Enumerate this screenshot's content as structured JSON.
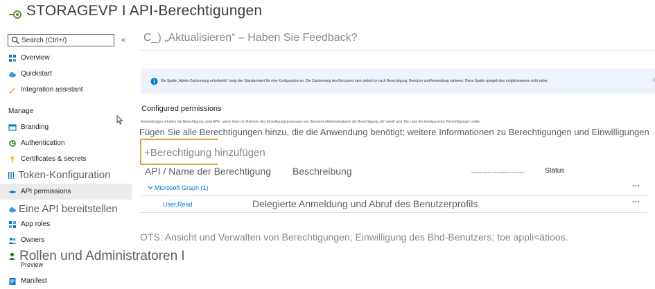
{
  "app": {
    "title": "STORAGEVP I API-Berechtigungen"
  },
  "sidebar": {
    "search_placeholder": "Search (Ctrl+/)",
    "collapse_label": "«",
    "manage_label": "Manage",
    "items": [
      {
        "label": "Overview",
        "icon": "grid-icon"
      },
      {
        "label": "Quickstart",
        "icon": "cloud-icon"
      },
      {
        "label": "Integration assistant",
        "icon": "rocket-icon"
      },
      {
        "label": "Branding",
        "icon": "branding-icon"
      },
      {
        "label": "Authentication",
        "icon": "authentication-icon"
      },
      {
        "label": "Certificates & secrets",
        "icon": "key-icon"
      },
      {
        "label": "Token-Konfiguration",
        "icon": "token-config-icon"
      },
      {
        "label": "API permissions",
        "icon": "api-permissions-icon"
      },
      {
        "label": "Eine API bereitstellen",
        "icon": "cloud-api-icon"
      },
      {
        "label": "App roles",
        "icon": "app-roles-icon"
      },
      {
        "label": "Owners",
        "icon": "owners-icon"
      },
      {
        "label": "Preview",
        "icon": ""
      },
      {
        "label": "Manifest",
        "icon": "manifest-icon"
      }
    ],
    "overlay_label": "Rollen und Administratoren I"
  },
  "command_bar": {
    "text": "C_) „Aktualisieren“ – Haben Sie Feedback?"
  },
  "info_bar": {
    "text": "Die Spalte „Admin-Zustimmung erforderlich“ zeigt den Standardwert für eine Konfiguration an. Die Zustimmung des Benutzers kann jedoch je nach Berechtigung, Benutzer und Anwendung variieren. Diese Spalte spiegelt dies möglicherweise nicht wider.",
    "more": "-I"
  },
  "configured": {
    "title": "Configured permissions",
    "description": "Anwendungen erhalten die Berechtigung „total APE“, wenn ihnen im Rahmen des Einwilligungsprozesses von Benutzern/Administratoren die Berechtigung „bb“ erteilt wird. Die Liste der konfigurierten Berechtigungen sollte",
    "description2": "Fügen Sie alle Berechtigungen hinzu, die die Anwendung benötigt; weitere Informationen zu Berechtigungen und Einwilligungen",
    "add_button_plus": "+",
    "add_button_label": "Berechtigung hinzufügen"
  },
  "table": {
    "headers": {
      "name": "API / Name der Berechtigung",
      "description": "Beschreibung",
      "admin_consent": "Zustimmung des Administrators erforderlich",
      "status": "Status"
    },
    "group": {
      "label": "Microsoft Graph (1)",
      "more": "···"
    },
    "rows": [
      {
        "name": "User.Read",
        "description": "Delegierte Anmeldung und Abruf des Benutzerprofils",
        "more": "···"
      }
    ]
  },
  "footer": {
    "text": "OTS: Ansicht und Verwalten von Berechtigungen; Einwilligung des Bhd-Benutzers; toe appli<ätioos."
  },
  "colors": {
    "link": "#0078d4",
    "accent_border": "#dca840",
    "info_bg": "#ecf3fc",
    "active_nav": "#edebe9"
  }
}
